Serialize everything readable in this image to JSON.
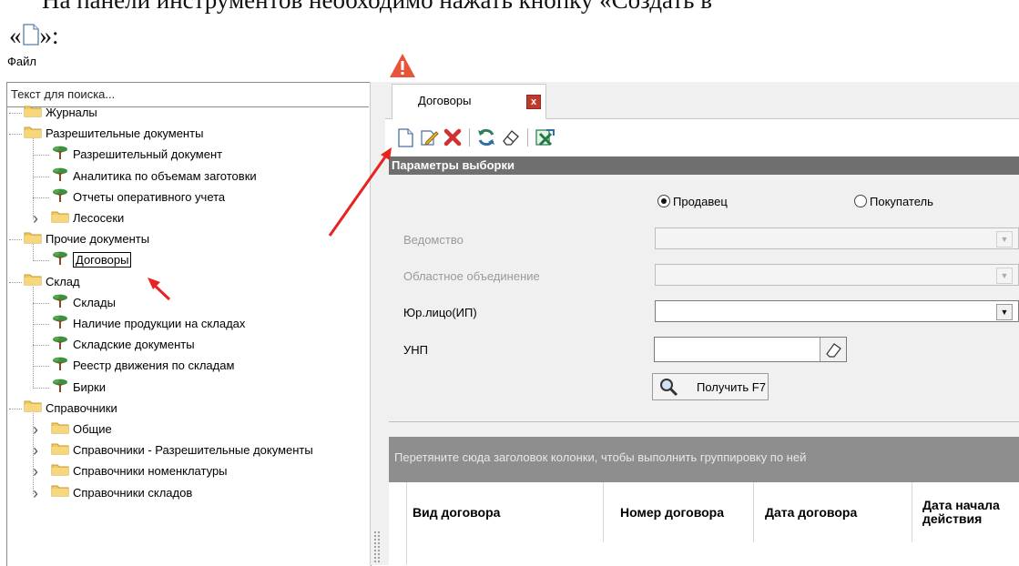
{
  "document": {
    "line1": "На панели инструментов необходимо нажать кнопку «Создать в",
    "line2_prefix": "«",
    "line2_suffix": "»:"
  },
  "menu": {
    "file": "Файл"
  },
  "search": {
    "placeholder": "Текст для поиска..."
  },
  "tree": [
    {
      "label": "Журналы",
      "level": 0,
      "icon": "folder-icon"
    },
    {
      "label": "Разрешительные документы",
      "level": 0,
      "icon": "folder-icon"
    },
    {
      "label": "Разрешительный документ",
      "level": 1,
      "icon": "tree-icon"
    },
    {
      "label": "Аналитика по объемам заготовки",
      "level": 1,
      "icon": "tree-icon"
    },
    {
      "label": "Отчеты оперативного учета",
      "level": 1,
      "icon": "tree-icon"
    },
    {
      "label": "Лесосеки",
      "level": 1,
      "icon": "folder-icon"
    },
    {
      "label": "Прочие документы",
      "level": 0,
      "icon": "folder-icon"
    },
    {
      "label": "Договоры",
      "level": 1,
      "icon": "tree-icon",
      "selected": true
    },
    {
      "label": "Склад",
      "level": 0,
      "icon": "folder-icon"
    },
    {
      "label": "Склады",
      "level": 1,
      "icon": "tree-icon"
    },
    {
      "label": "Наличие продукции на складах",
      "level": 1,
      "icon": "tree-icon"
    },
    {
      "label": "Складские документы",
      "level": 1,
      "icon": "tree-icon"
    },
    {
      "label": "Реестр движения по складам",
      "level": 1,
      "icon": "tree-icon"
    },
    {
      "label": "Бирки",
      "level": 1,
      "icon": "tree-icon"
    },
    {
      "label": "Справочники",
      "level": 0,
      "icon": "folder-icon"
    },
    {
      "label": "Общие",
      "level": 1,
      "icon": "folder-icon"
    },
    {
      "label": "Справочники - Разрешительные документы",
      "level": 1,
      "icon": "folder-icon"
    },
    {
      "label": "Справочники номенклатуры",
      "level": 1,
      "icon": "folder-icon"
    },
    {
      "label": "Справочники складов",
      "level": 1,
      "icon": "folder-icon"
    }
  ],
  "tab": {
    "label": "Договоры",
    "close": "x"
  },
  "toolbar": [
    "new-document-icon",
    "edit-icon",
    "delete-icon",
    "refresh-icon",
    "eraser-icon",
    "excel-export-icon"
  ],
  "params": {
    "title": "Параметры выборки",
    "radio_seller": "Продавец",
    "radio_buyer": "Покупатель",
    "selected_radio": "Продавец",
    "vedomstvo": "Ведомство",
    "oblast": "Областное объединение",
    "legal": "Юр.лицо(ИП)",
    "unp": "УНП",
    "get_button": "Получить F7"
  },
  "grid": {
    "group_hint": "Перетяните сюда заголовок колонки, чтобы выполнить группировку по ней",
    "columns": [
      "Вид договора",
      "Номер договора",
      "Дата договора",
      "Дата начала действия"
    ]
  },
  "colors": {
    "accent_arrow": "#e8231f",
    "params_header": "#6f6f6f",
    "group_panel": "#8e8e8e"
  }
}
